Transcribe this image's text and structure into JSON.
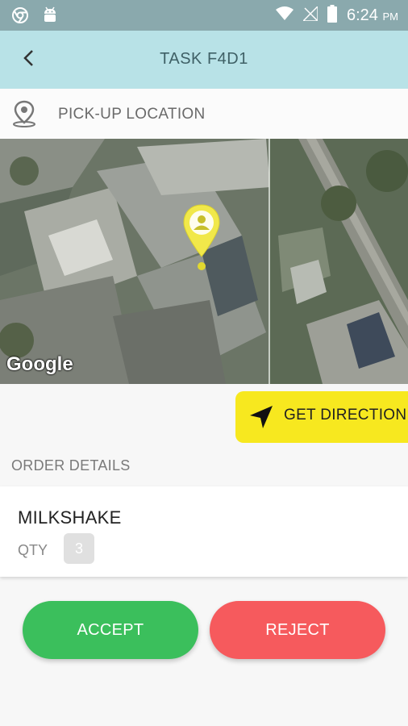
{
  "status_bar": {
    "time": "6:24",
    "ampm": "PM"
  },
  "header": {
    "title": "TASK F4D1"
  },
  "pickup": {
    "label": "PICK-UP LOCATION"
  },
  "map": {
    "attribution": "Google"
  },
  "direction": {
    "label": "GET DIRECTION"
  },
  "order": {
    "header": "ORDER DETAILS",
    "item_name": "MILKSHAKE",
    "qty_label": "QTY",
    "qty_value": "3"
  },
  "actions": {
    "accept_label": "ACCEPT",
    "reject_label": "REJECT"
  },
  "colors": {
    "accent_yellow": "#f7e81f",
    "accept_green": "#3bbf5c",
    "reject_red": "#f65a5d",
    "header_bg": "#b8e2e7"
  }
}
